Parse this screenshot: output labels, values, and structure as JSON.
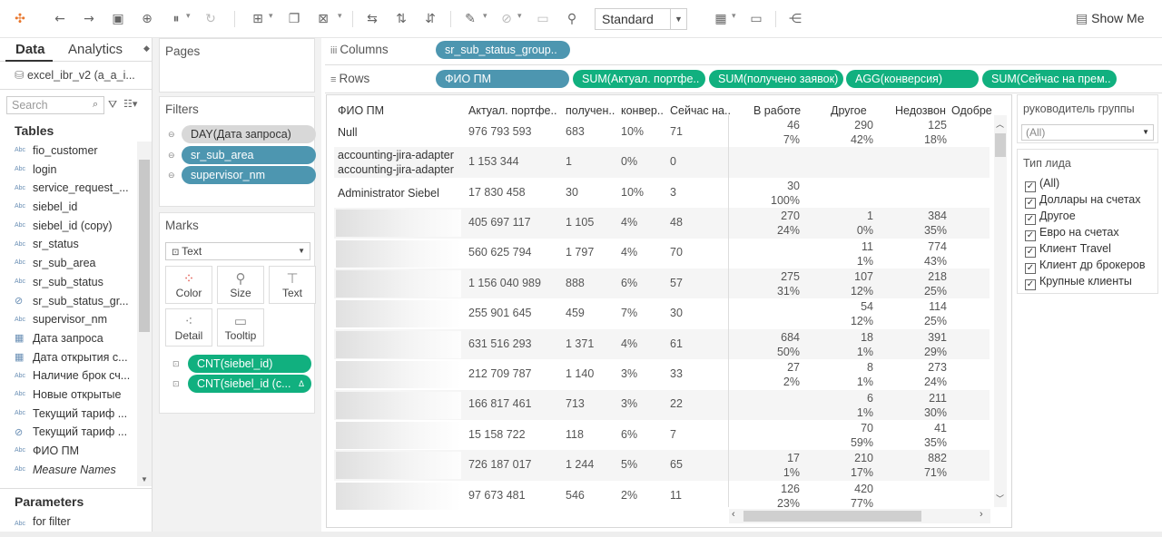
{
  "toolbar": {
    "fit_value": "Standard",
    "show_me": "Show Me",
    "icons": [
      "tableau-logo-icon",
      "undo-icon",
      "redo-icon",
      "save-icon",
      "new-datasource-icon",
      "pause-icon",
      "refresh-icon",
      "new-worksheet-icon",
      "duplicate-icon",
      "clear-icon",
      "swap-icon",
      "sort-asc-icon",
      "sort-desc-icon",
      "highlight-icon",
      "group-icon",
      "label-icon",
      "pin-icon",
      "device-icon",
      "presentation-icon",
      "share-icon"
    ]
  },
  "data_pane": {
    "tab_data": "Data",
    "tab_analytics": "Analytics",
    "datasource": "excel_ibr_v2 (a_a_i...",
    "search_placeholder": "Search",
    "tables_title": "Tables",
    "fields": [
      {
        "name": "fio_customer",
        "type": "Abc"
      },
      {
        "name": "login",
        "type": "Abc"
      },
      {
        "name": "service_request_...",
        "type": "Abc"
      },
      {
        "name": "siebel_id",
        "type": "Abc"
      },
      {
        "name": "siebel_id (copy)",
        "type": "Abc"
      },
      {
        "name": "sr_status",
        "type": "Abc"
      },
      {
        "name": "sr_sub_area",
        "type": "Abc"
      },
      {
        "name": "sr_sub_status",
        "type": "Abc"
      },
      {
        "name": "sr_sub_status_gr...",
        "type": "calc"
      },
      {
        "name": "supervisor_nm",
        "type": "Abc"
      },
      {
        "name": "Дата запроса",
        "type": "date"
      },
      {
        "name": "Дата открытия с...",
        "type": "date"
      },
      {
        "name": "Наличие брок сч...",
        "type": "Abc"
      },
      {
        "name": "Новые открытые",
        "type": "Abc"
      },
      {
        "name": "Текущий тариф ...",
        "type": "Abc"
      },
      {
        "name": "Текущий тариф ...",
        "type": "calc"
      },
      {
        "name": "ФИО ПМ",
        "type": "Abc"
      },
      {
        "name": "Measure Names",
        "type": "Abc"
      }
    ],
    "parameters_title": "Parameters",
    "parameters": [
      {
        "name": "for filter",
        "type": "Abc"
      }
    ]
  },
  "pages": {
    "title": "Pages"
  },
  "filters": {
    "title": "Filters",
    "items": [
      "DAY(Дата запроса)",
      "sr_sub_area",
      "supervisor_nm"
    ]
  },
  "marks": {
    "title": "Marks",
    "type": "Text",
    "buttons": [
      "Color",
      "Size",
      "Text",
      "Detail",
      "Tooltip"
    ],
    "fields": [
      "CNT(siebel_id)",
      "CNT(siebel_id (c..."
    ]
  },
  "shelves": {
    "columns_label": "Columns",
    "rows_label": "Rows",
    "columns": [
      "sr_sub_status_group.."
    ],
    "rows": [
      "ФИО ПМ",
      "SUM(Актуал. портфе..",
      "SUM(получено заявок)",
      "AGG(конверсия)",
      "SUM(Сейчас на прем.."
    ]
  },
  "view": {
    "headers": [
      "ФИО ПМ",
      "Актуал. портфе..",
      "получен..",
      "конвер..",
      "Сейчас на..",
      "В работе",
      "Другое",
      "Недозвон",
      "Одобре"
    ],
    "rows": [
      {
        "name": [
          "Null"
        ],
        "portfolio": "976 793 593",
        "received": "683",
        "conv": "10%",
        "now": "71",
        "work": [
          "46",
          "7%"
        ],
        "other": [
          "290",
          "42%"
        ],
        "nocall": [
          "125",
          "18%"
        ]
      },
      {
        "name": [
          "accounting-jira-adapter",
          "accounting-jira-adapter"
        ],
        "portfolio": "1 153 344",
        "received": "1",
        "conv": "0%",
        "now": "0",
        "work": [
          "",
          ""
        ],
        "other": [
          "",
          ""
        ],
        "nocall": [
          "",
          ""
        ]
      },
      {
        "name": [
          "Administrator Siebel"
        ],
        "portfolio": "17 830 458",
        "received": "30",
        "conv": "10%",
        "now": "3",
        "work": [
          "30",
          "100%"
        ],
        "other": [
          "",
          ""
        ],
        "nocall": [
          "",
          ""
        ]
      },
      {
        "name": [],
        "portfolio": "405 697 117",
        "received": "1 105",
        "conv": "4%",
        "now": "48",
        "work": [
          "270",
          "24%"
        ],
        "other": [
          "1",
          "0%"
        ],
        "nocall": [
          "384",
          "35%"
        ]
      },
      {
        "name": [],
        "portfolio": "560 625 794",
        "received": "1 797",
        "conv": "4%",
        "now": "70",
        "work": [
          "",
          ""
        ],
        "other": [
          "11",
          "1%"
        ],
        "nocall": [
          "774",
          "43%"
        ]
      },
      {
        "name": [],
        "portfolio": "1 156 040 989",
        "received": "888",
        "conv": "6%",
        "now": "57",
        "work": [
          "275",
          "31%"
        ],
        "other": [
          "107",
          "12%"
        ],
        "nocall": [
          "218",
          "25%"
        ]
      },
      {
        "name": [],
        "portfolio": "255 901 645",
        "received": "459",
        "conv": "7%",
        "now": "30",
        "work": [
          "",
          ""
        ],
        "other": [
          "54",
          "12%"
        ],
        "nocall": [
          "114",
          "25%"
        ]
      },
      {
        "name": [],
        "portfolio": "631 516 293",
        "received": "1 371",
        "conv": "4%",
        "now": "61",
        "work": [
          "684",
          "50%"
        ],
        "other": [
          "18",
          "1%"
        ],
        "nocall": [
          "391",
          "29%"
        ]
      },
      {
        "name": [],
        "portfolio": "212 709 787",
        "received": "1 140",
        "conv": "3%",
        "now": "33",
        "work": [
          "27",
          "2%"
        ],
        "other": [
          "8",
          "1%"
        ],
        "nocall": [
          "273",
          "24%"
        ]
      },
      {
        "name": [],
        "portfolio": "166 817 461",
        "received": "713",
        "conv": "3%",
        "now": "22",
        "work": [
          "",
          ""
        ],
        "other": [
          "6",
          "1%"
        ],
        "nocall": [
          "211",
          "30%"
        ]
      },
      {
        "name": [],
        "portfolio": "15 158 722",
        "received": "118",
        "conv": "6%",
        "now": "7",
        "work": [
          "",
          ""
        ],
        "other": [
          "70",
          "59%"
        ],
        "nocall": [
          "41",
          "35%"
        ]
      },
      {
        "name": [],
        "portfolio": "726 187 017",
        "received": "1 244",
        "conv": "5%",
        "now": "65",
        "work": [
          "17",
          "1%"
        ],
        "other": [
          "210",
          "17%"
        ],
        "nocall": [
          "882",
          "71%"
        ]
      },
      {
        "name": [],
        "portfolio": "97 673 481",
        "received": "546",
        "conv": "2%",
        "now": "11",
        "work": [
          "126",
          "23%"
        ],
        "other": [
          "420",
          "77%"
        ],
        "nocall": [
          "",
          ""
        ]
      }
    ]
  },
  "filter_cards": {
    "supervisor_title": "руководитель группы",
    "supervisor_value": "(All)",
    "lead_title": "Тип лида",
    "lead_options": [
      "(All)",
      "Доллары на счетах",
      "Другое",
      "Евро на счетах",
      "Клиент Travel",
      "Клиент др брокеров",
      "Крупные клиенты"
    ]
  }
}
